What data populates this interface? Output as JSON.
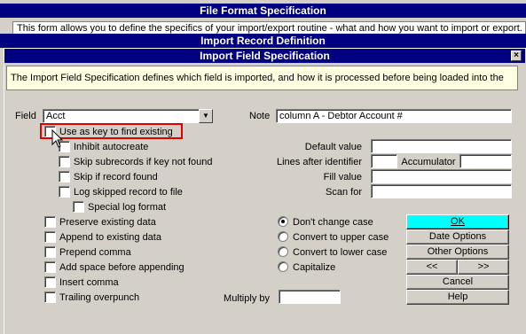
{
  "windows": {
    "file_format": {
      "title": "File Format Specification",
      "description": "This form allows you to define the specifics of your import/export routine - what and how you want to import or export. Whe"
    },
    "import_record": {
      "title": "Import Record Definition"
    },
    "import_field": {
      "title": "Import Field Specification",
      "description": "The Import Field Specification defines which field is imported, and how it is processed before being loaded into the",
      "close_glyph": "×"
    }
  },
  "form": {
    "field": {
      "label": "Field",
      "value": "Acct",
      "arrow_glyph": "▼"
    },
    "note": {
      "label": "Note",
      "value": "column A - Debtor Account #"
    },
    "key_options": [
      {
        "label": "Use as key to find existing",
        "checked": false
      },
      {
        "label": "Inhibit autocreate",
        "checked": false
      },
      {
        "label": "Skip subrecords if key not found",
        "checked": false
      },
      {
        "label": "Skip if record found",
        "checked": false
      },
      {
        "label": "Log skipped record to file",
        "checked": false
      },
      {
        "label": "Special log format",
        "checked": false
      }
    ],
    "default_value": {
      "label": "Default value",
      "value": ""
    },
    "lines_after_identifier": {
      "label": "Lines after identifier",
      "value": ""
    },
    "accumulator": {
      "label": "Accumulator",
      "value": ""
    },
    "fill_value": {
      "label": "Fill value",
      "value": ""
    },
    "scan_for": {
      "label": "Scan for",
      "value": ""
    },
    "processing_options": [
      {
        "label": "Preserve existing data",
        "checked": false
      },
      {
        "label": "Append to existing data",
        "checked": false
      },
      {
        "label": "Prepend comma",
        "checked": false
      },
      {
        "label": "Add space before appending",
        "checked": false
      },
      {
        "label": "Insert comma",
        "checked": false
      },
      {
        "label": "Trailing overpunch",
        "checked": false
      }
    ],
    "case_options": {
      "selected": "Don't change case",
      "options": [
        "Don't change case",
        "Convert to upper case",
        "Convert to lower case",
        "Capitalize"
      ]
    },
    "multiply_by": {
      "label": "Multiply by",
      "value": ""
    }
  },
  "buttons": {
    "ok": "OK",
    "date_options": "Date Options",
    "other_options": "Other Options",
    "prev": "<<",
    "next": ">>",
    "cancel": "Cancel",
    "help": "Help"
  },
  "colors": {
    "title_bar": "#000080",
    "dialog_face": "#d4d0c8",
    "info_background": "#ffffe1",
    "ok_button": "#00ffff",
    "highlight_border": "#e00000"
  }
}
